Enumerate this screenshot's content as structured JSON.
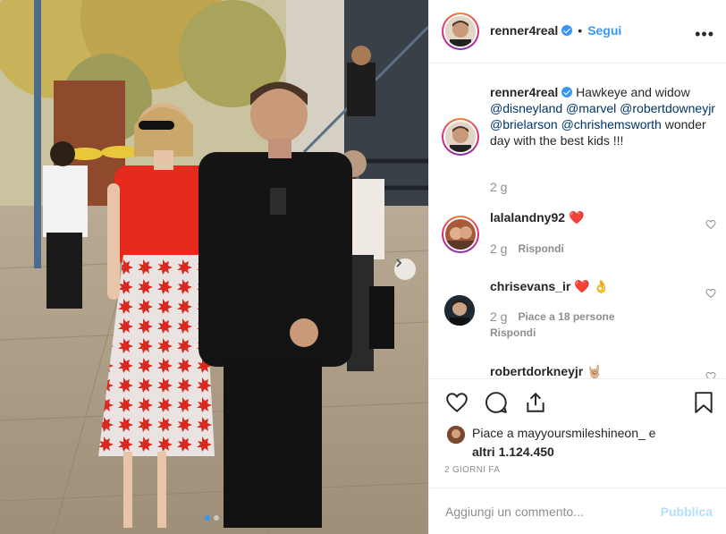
{
  "post": {
    "author": "renner4real",
    "follow_label": "Segui",
    "follow_separator": "•",
    "more_label": "•••"
  },
  "caption": {
    "author": "renner4real",
    "text_1": "Hawkeye and widow",
    "mention_1": "@disneyland",
    "mention_2": "@marvel",
    "mention_3": "@robertdowneyjr",
    "mention_4": "@brielarson",
    "mention_5": "@chrishemsworth",
    "text_2": "wonder day with the best kids !!!",
    "age": "2 g"
  },
  "comments": [
    {
      "user": "lalalandny92",
      "text": "❤️",
      "age": "2 g",
      "reply": "Rispondi"
    },
    {
      "user": "chrisevans_ir",
      "text": "❤️ 👌",
      "age": "2 g",
      "likes": "Piace a 18 persone",
      "reply": "Rispondi"
    },
    {
      "user": "robertdorkneyjr",
      "text": "🤘🏼"
    }
  ],
  "likes": {
    "line_1": "Piace a mayyoursmileshineon_ e",
    "line_2": "altri 1.124.450"
  },
  "timestamp": "2 GIORNI FA",
  "add_comment": {
    "placeholder": "Aggiungi un commento...",
    "publish_label": "Pubblica"
  },
  "colors": {
    "accent": "#3897f0",
    "publish_disabled": "#b2dffc",
    "secondary_text": "#8e8e8e",
    "heart_red": "#ed4956"
  },
  "carousel": {
    "slide_count": 2,
    "active_slide": 1
  }
}
